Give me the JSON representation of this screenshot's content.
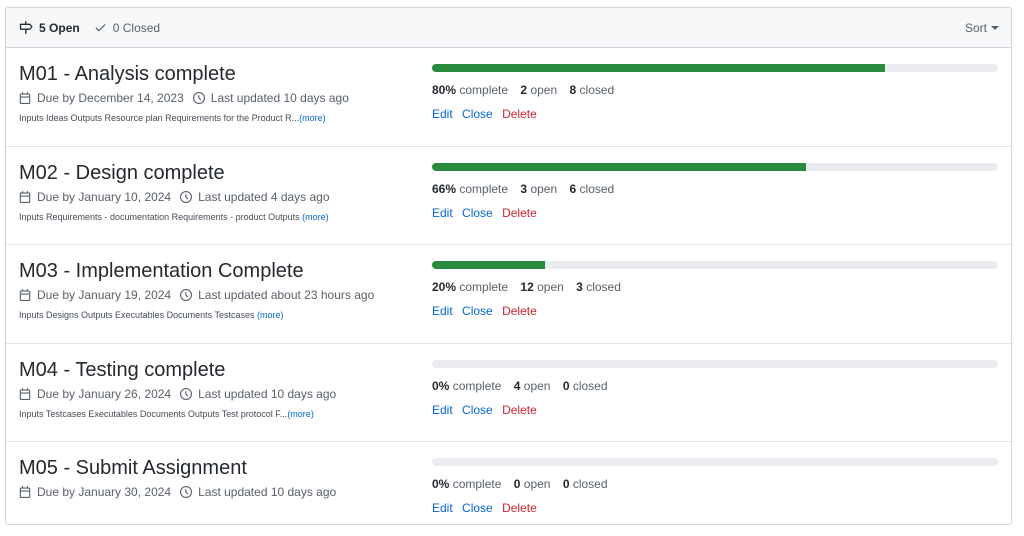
{
  "header": {
    "open_count": "5",
    "open_label": "Open",
    "closed_count": "0",
    "closed_label": "Closed",
    "sort_label": "Sort",
    "icons": {
      "open": "milestone-icon",
      "closed": "check-icon",
      "sort": "caret-down-icon"
    }
  },
  "colors": {
    "progress": "#2a8a3e",
    "link": "#0366d6",
    "delete": "#cb2431"
  },
  "milestones": [
    {
      "title": "M01 - Analysis complete",
      "due": "Due by December 14, 2023",
      "updated": "Last updated 10 days ago",
      "description": "Inputs Ideas Outputs Resource plan Requirements for the Product R...",
      "more": "(more)",
      "progress": 80,
      "percent": "80%",
      "percent_label": "complete",
      "open": "2",
      "open_label": "open",
      "closed": "8",
      "closed_label": "closed",
      "edit": "Edit",
      "close": "Close",
      "delete": "Delete"
    },
    {
      "title": "M02 - Design complete",
      "due": "Due by January 10, 2024",
      "updated": "Last updated 4 days ago",
      "description": "Inputs Requirements - documentation Requirements - product Outputs ",
      "more": "(more)",
      "progress": 66,
      "percent": "66%",
      "percent_label": "complete",
      "open": "3",
      "open_label": "open",
      "closed": "6",
      "closed_label": "closed",
      "edit": "Edit",
      "close": "Close",
      "delete": "Delete"
    },
    {
      "title": "M03 - Implementation Complete",
      "due": "Due by January 19, 2024",
      "updated": "Last updated about 23 hours ago",
      "description": "Inputs Designs Outputs Executables Documents Testcases ",
      "more": "(more)",
      "progress": 20,
      "percent": "20%",
      "percent_label": "complete",
      "open": "12",
      "open_label": "open",
      "closed": "3",
      "closed_label": "closed",
      "edit": "Edit",
      "close": "Close",
      "delete": "Delete"
    },
    {
      "title": "M04 - Testing complete",
      "due": "Due by January 26, 2024",
      "updated": "Last updated 10 days ago",
      "description": "Inputs Testcases Executables Documents Outputs Test protocol F...",
      "more": "(more)",
      "progress": 0,
      "percent": "0%",
      "percent_label": "complete",
      "open": "4",
      "open_label": "open",
      "closed": "0",
      "closed_label": "closed",
      "edit": "Edit",
      "close": "Close",
      "delete": "Delete"
    },
    {
      "title": "M05 - Submit Assignment",
      "due": "Due by January 30, 2024",
      "updated": "Last updated 10 days ago",
      "description": "",
      "more": "",
      "progress": 0,
      "percent": "0%",
      "percent_label": "complete",
      "open": "0",
      "open_label": "open",
      "closed": "0",
      "closed_label": "closed",
      "edit": "Edit",
      "close": "Close",
      "delete": "Delete"
    }
  ]
}
